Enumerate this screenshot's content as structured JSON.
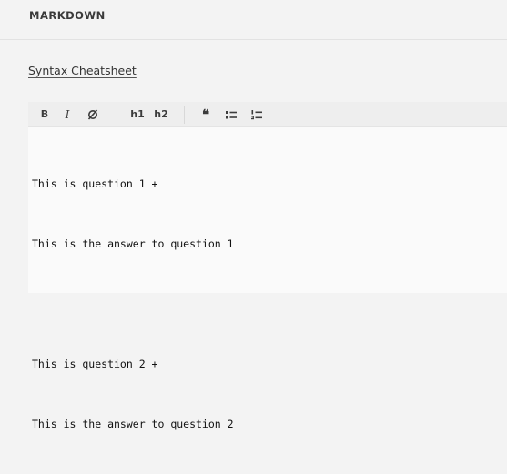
{
  "section": {
    "title": "MARKDOWN"
  },
  "cheatsheet": {
    "label": "Syntax Cheatsheet"
  },
  "toolbar": {
    "bold_label": "B",
    "italic_label": "I",
    "strike_icon": "strikethrough-icon",
    "h1_label": "h1",
    "h2_label": "h2",
    "quote_label": "❝",
    "unordered_list_icon": "unordered-list-icon",
    "ordered_list_icon": "ordered-list-icon"
  },
  "editor": {
    "lines": [
      "This is question 1 +",
      "This is the answer to question 1",
      "",
      "This is question 2 +",
      "This is the answer to question 2"
    ]
  }
}
